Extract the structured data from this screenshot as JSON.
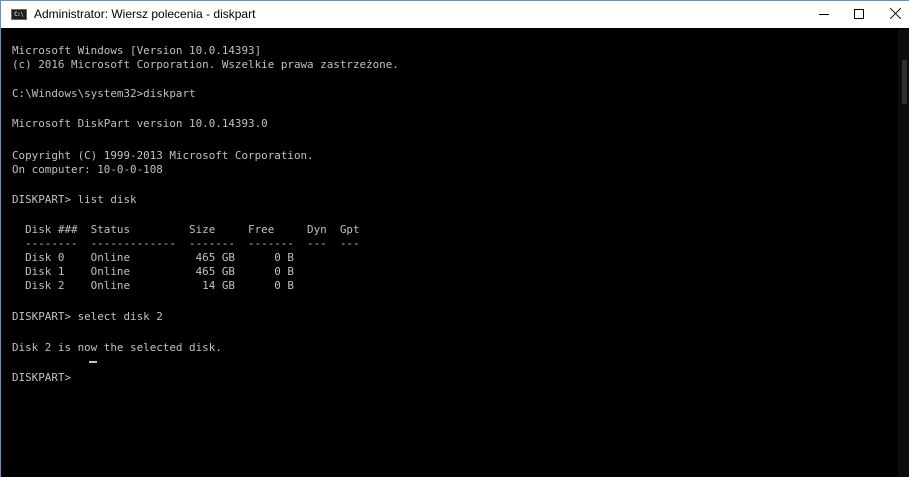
{
  "window": {
    "title": "Administrator: Wiersz polecenia - diskpart",
    "icon": "cmd-icon",
    "icon_glyph": "C:\\",
    "controls": {
      "minimize": "minimize-icon",
      "maximize": "maximize-icon",
      "close": "close-icon"
    }
  },
  "console": {
    "text_color": "#c0c0c0",
    "background": "#000000",
    "lines": [
      "Microsoft Windows [Version 10.0.14393]",
      "(c) 2016 Microsoft Corporation. Wszelkie prawa zastrzeżone.",
      "C:\\Windows\\system32>diskpart",
      "Microsoft DiskPart version 10.0.14393.0",
      "Copyright (C) 1999-2013 Microsoft Corporation.",
      "On computer: 10-0-0-108",
      "DISKPART> list disk",
      "  Disk ###  Status         Size     Free     Dyn  Gpt",
      "  --------  -------------  -------  -------  ---  ---",
      "  Disk 0    Online          465 GB      0 B",
      "  Disk 1    Online          465 GB      0 B",
      "  Disk 2    Online           14 GB      0 B",
      "DISKPART> select disk 2",
      "Disk 2 is now the selected disk.",
      "DISKPART> "
    ]
  }
}
